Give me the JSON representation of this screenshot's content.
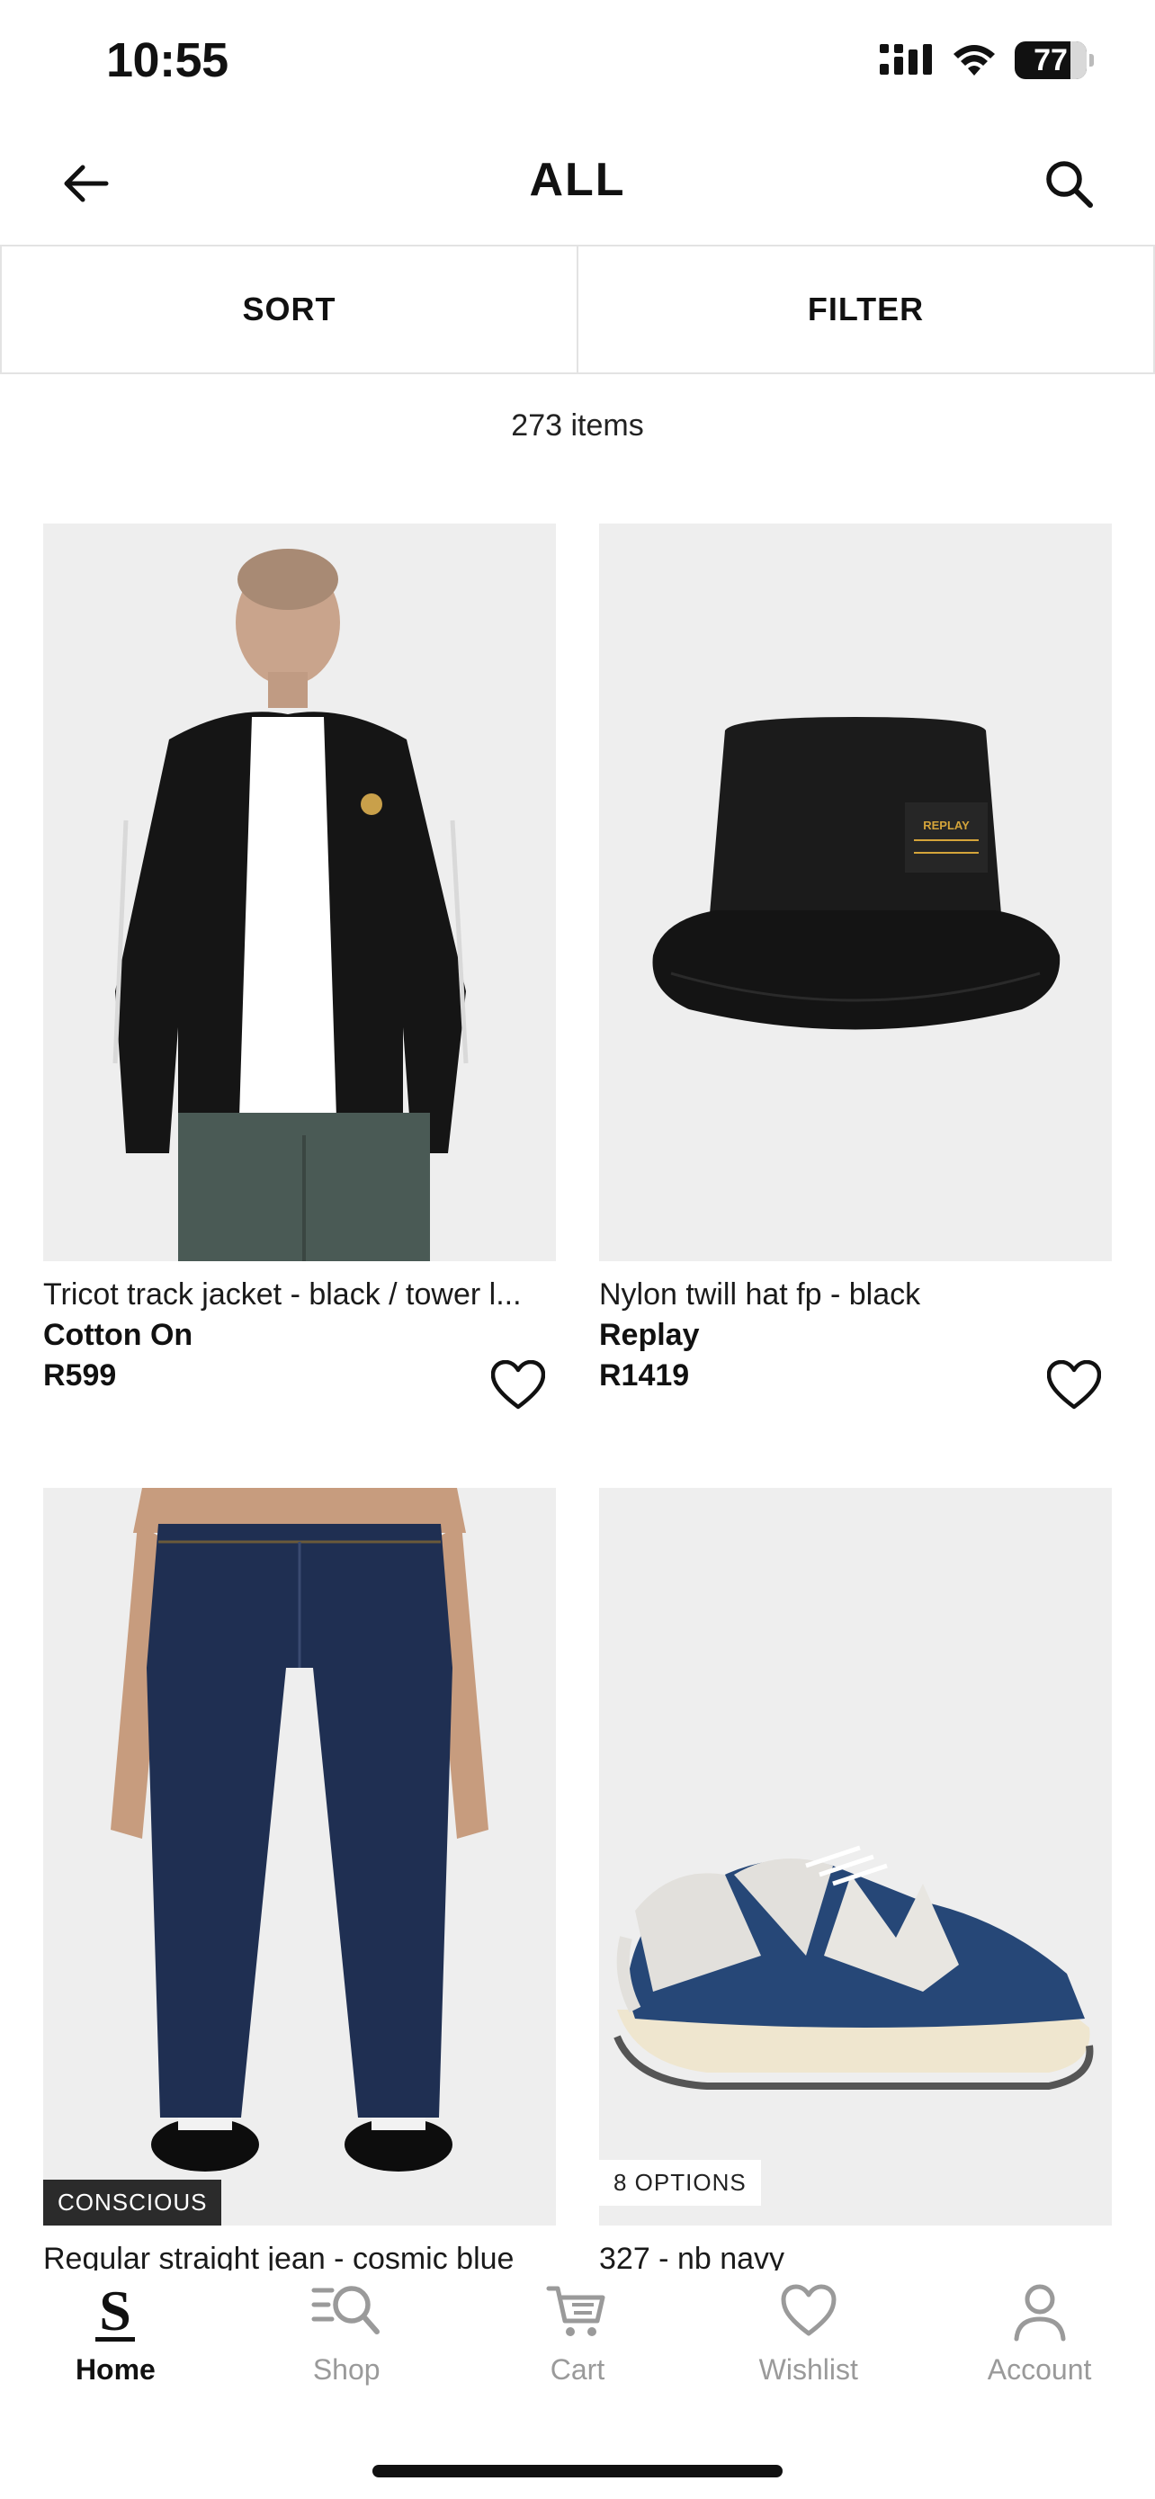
{
  "status_bar": {
    "time": "10:55",
    "battery": "77",
    "icons": [
      "signal-icon",
      "wifi-icon",
      "battery-icon"
    ]
  },
  "header": {
    "title": "ALL",
    "back_icon": "arrow-left-icon",
    "search_icon": "search-icon"
  },
  "toolbar": {
    "sort_label": "SORT",
    "filter_label": "FILTER"
  },
  "results": {
    "count_text": "273 items"
  },
  "products": [
    {
      "name": "Tricot track jacket - black / tower l...",
      "brand": "Cotton On",
      "price": "R599",
      "image": "black-track-jacket-model"
    },
    {
      "name": "Nylon twill hat fp - black",
      "brand": "Replay",
      "price": "R1419",
      "image": "black-bucket-hat",
      "label_text": "REPLAY"
    },
    {
      "name": "Regular straight jean - cosmic blue",
      "badge": "CONSCIOUS",
      "image": "dark-denim-jeans-model"
    },
    {
      "name": "327 - nb navy",
      "badge": "8 OPTIONS",
      "image": "navy-sneaker"
    }
  ],
  "bottom_nav": {
    "items": [
      {
        "label": "Home",
        "icon": "home-s-icon",
        "active": true
      },
      {
        "label": "Shop",
        "icon": "shop-search-icon",
        "active": false
      },
      {
        "label": "Cart",
        "icon": "cart-icon",
        "active": false
      },
      {
        "label": "Wishlist",
        "icon": "heart-icon",
        "active": false
      },
      {
        "label": "Account",
        "icon": "account-icon",
        "active": false
      }
    ]
  },
  "colors": {
    "text": "#111111",
    "muted": "#9a9a9a",
    "image_bg": "#efefef",
    "badge_dark": "#2b2b2b",
    "divider": "#e3e3e3"
  }
}
